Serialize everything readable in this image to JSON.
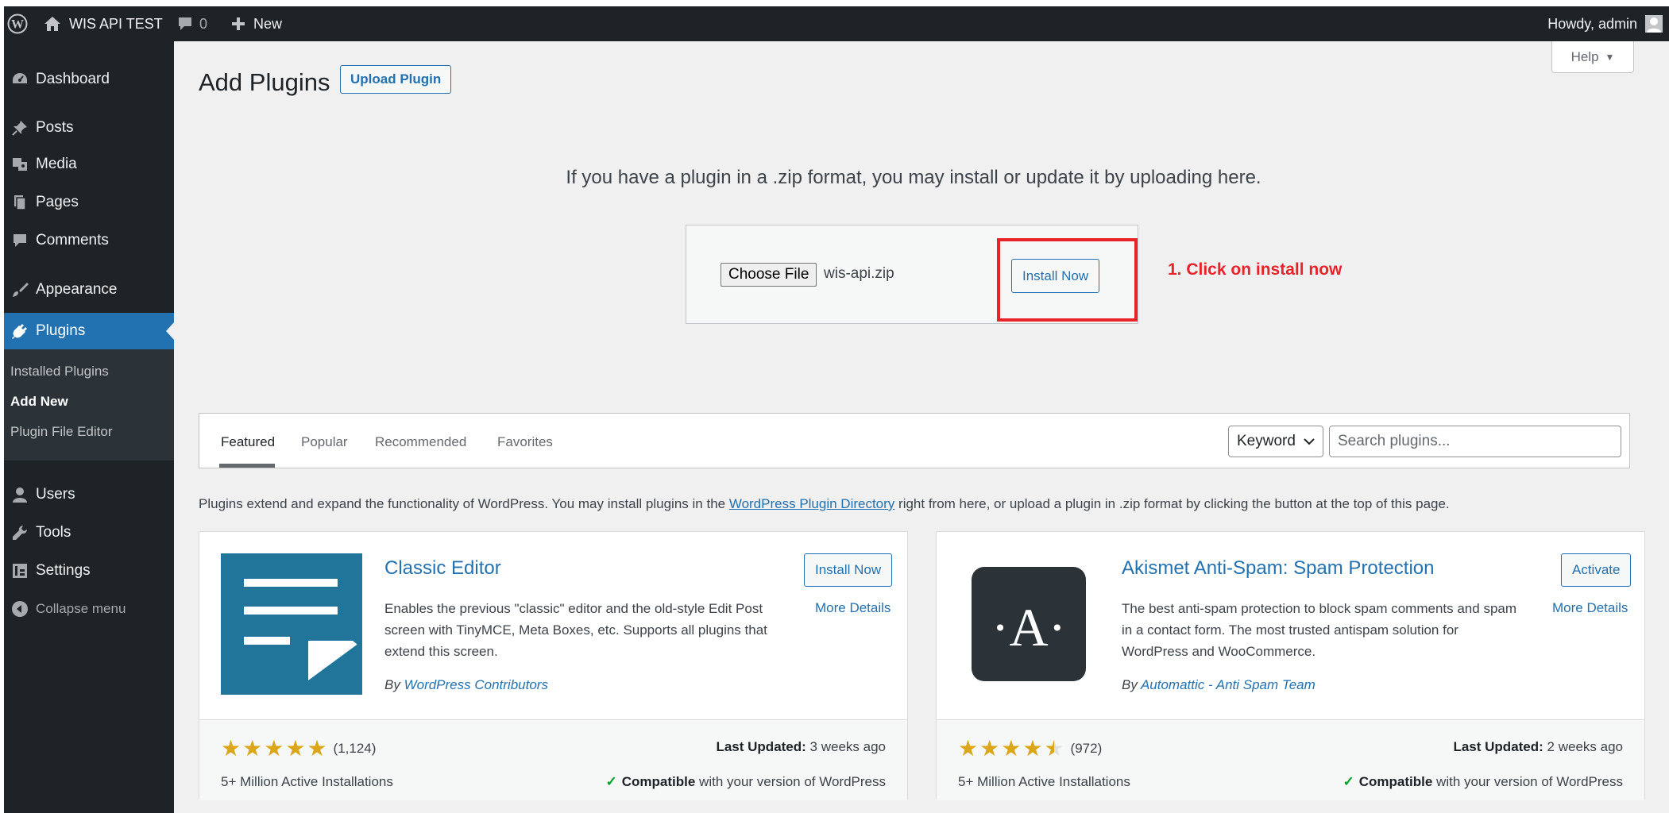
{
  "admin_bar": {
    "site_name": "WIS API TEST",
    "comment_count": "0",
    "new_label": "New",
    "howdy": "Howdy, admin"
  },
  "sidebar": {
    "items": [
      {
        "label": "Dashboard",
        "icon": "dashboard-icon"
      },
      {
        "label": "Posts",
        "icon": "pushpin-icon"
      },
      {
        "label": "Media",
        "icon": "media-icon"
      },
      {
        "label": "Pages",
        "icon": "pages-icon"
      },
      {
        "label": "Comments",
        "icon": "comment-icon"
      },
      {
        "label": "Appearance",
        "icon": "brush-icon"
      },
      {
        "label": "Plugins",
        "icon": "plug-icon"
      },
      {
        "label": "Users",
        "icon": "user-icon"
      },
      {
        "label": "Tools",
        "icon": "wrench-icon"
      },
      {
        "label": "Settings",
        "icon": "settings-icon"
      }
    ],
    "submenu": [
      "Installed Plugins",
      "Add New",
      "Plugin File Editor"
    ],
    "collapse_label": "Collapse menu"
  },
  "page": {
    "title": "Add Plugins",
    "upload_button": "Upload Plugin",
    "help_label": "Help"
  },
  "upload": {
    "description": "If you have a plugin in a .zip format, you may install or update it by uploading here.",
    "choose_file_label": "Choose File",
    "file_name": "wis-api.zip",
    "install_now_label": "Install Now",
    "annotation": "1. Click on install now"
  },
  "filter": {
    "tabs": [
      "Featured",
      "Popular",
      "Recommended",
      "Favorites"
    ],
    "search_type": "Keyword",
    "search_placeholder": "Search plugins..."
  },
  "intro": {
    "before_link": "Plugins extend and expand the functionality of WordPress. You may install plugins in the ",
    "link_text": "WordPress Plugin Directory",
    "after_link": " right from here, or upload a plugin in .zip format by clicking the button at the top of this page."
  },
  "plugins": [
    {
      "name": "Classic Editor",
      "description": "Enables the previous \"classic\" editor and the old-style Edit Post screen with TinyMCE, Meta Boxes, etc. Supports all plugins that extend this screen.",
      "by_label": "By ",
      "author": "WordPress Contributors",
      "action_label": "Install Now",
      "more_details": "More Details",
      "rating": 5,
      "rating_count": "(1,124)",
      "installs": "5+ Million Active Installations",
      "last_updated_label": "Last Updated:",
      "last_updated": " 3 weeks ago",
      "compatible_label": "Compatible",
      "compatible_text": " with your version of WordPress",
      "icon_color": "#21759b"
    },
    {
      "name": "Akismet Anti-Spam: Spam Protection",
      "description": "The best anti-spam protection to block spam comments and spam in a contact form. The most trusted antispam solution for WordPress and WooCommerce.",
      "by_label": "By ",
      "author": "Automattic - Anti Spam Team",
      "action_label": "Activate",
      "more_details": "More Details",
      "rating": 4.5,
      "rating_count": "(972)",
      "installs": "5+ Million Active Installations",
      "last_updated_label": "Last Updated:",
      "last_updated": " 2 weeks ago",
      "compatible_label": "Compatible",
      "compatible_text": " with your version of WordPress",
      "icon_color": "#2c3338",
      "icon_letter": "·A·"
    }
  ],
  "colors": {
    "admin_dark": "#1d2327",
    "accent": "#2271b1",
    "annotation_red": "#e8232a",
    "star": "#dba617",
    "check_green": "#00a32a"
  }
}
